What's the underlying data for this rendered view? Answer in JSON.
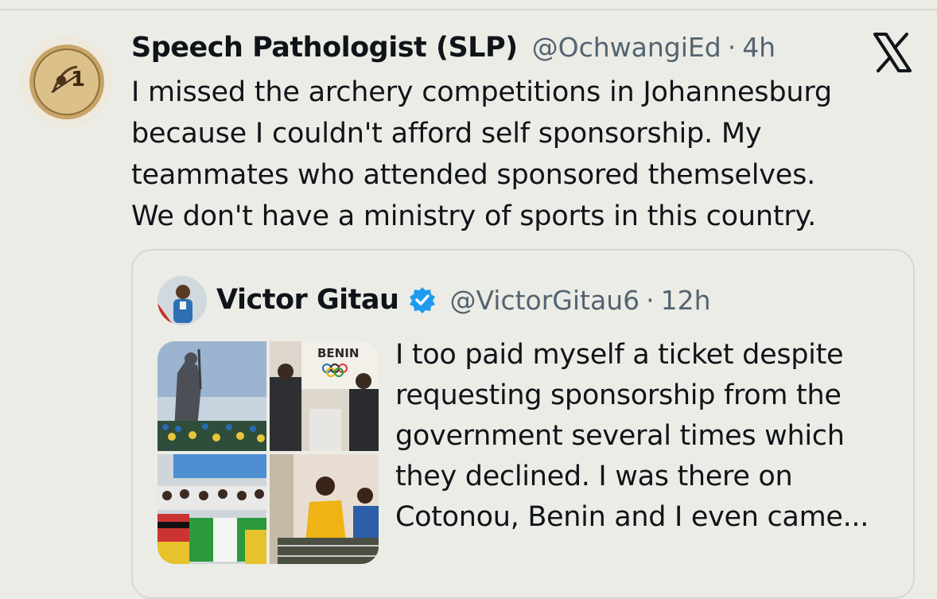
{
  "tweet": {
    "author_name": "Speech Pathologist (SLP)",
    "author_handle": "@OchwangiEd",
    "separator": "·",
    "time": "4h",
    "text": "I missed the archery competitions in Johannesburg\nbecause I couldn't afford self sponsorship. My\nteammates who attended sponsored themselves.\nWe don't have a ministry of sports in this country.",
    "avatar_icon": "archery-medal-avatar",
    "platform_icon": "x-logo-icon"
  },
  "quoted_tweet": {
    "author_name": "Victor Gitau",
    "author_handle": "@VictorGitau6",
    "separator": "·",
    "time": "12h",
    "verified": true,
    "verified_color": "#1d9bf0",
    "text": "I too paid myself a ticket despite\nrequesting sponsorship from the\ngovernment several times which\nthey declined. I was there on\nCotonou, Benin and I even came...",
    "media": {
      "count": 4,
      "banner_text": "BENIN"
    }
  },
  "colors": {
    "background": "#ecece6",
    "text": "#0f1419",
    "secondary_text": "#536471",
    "card_border": "#d4d7d3"
  }
}
